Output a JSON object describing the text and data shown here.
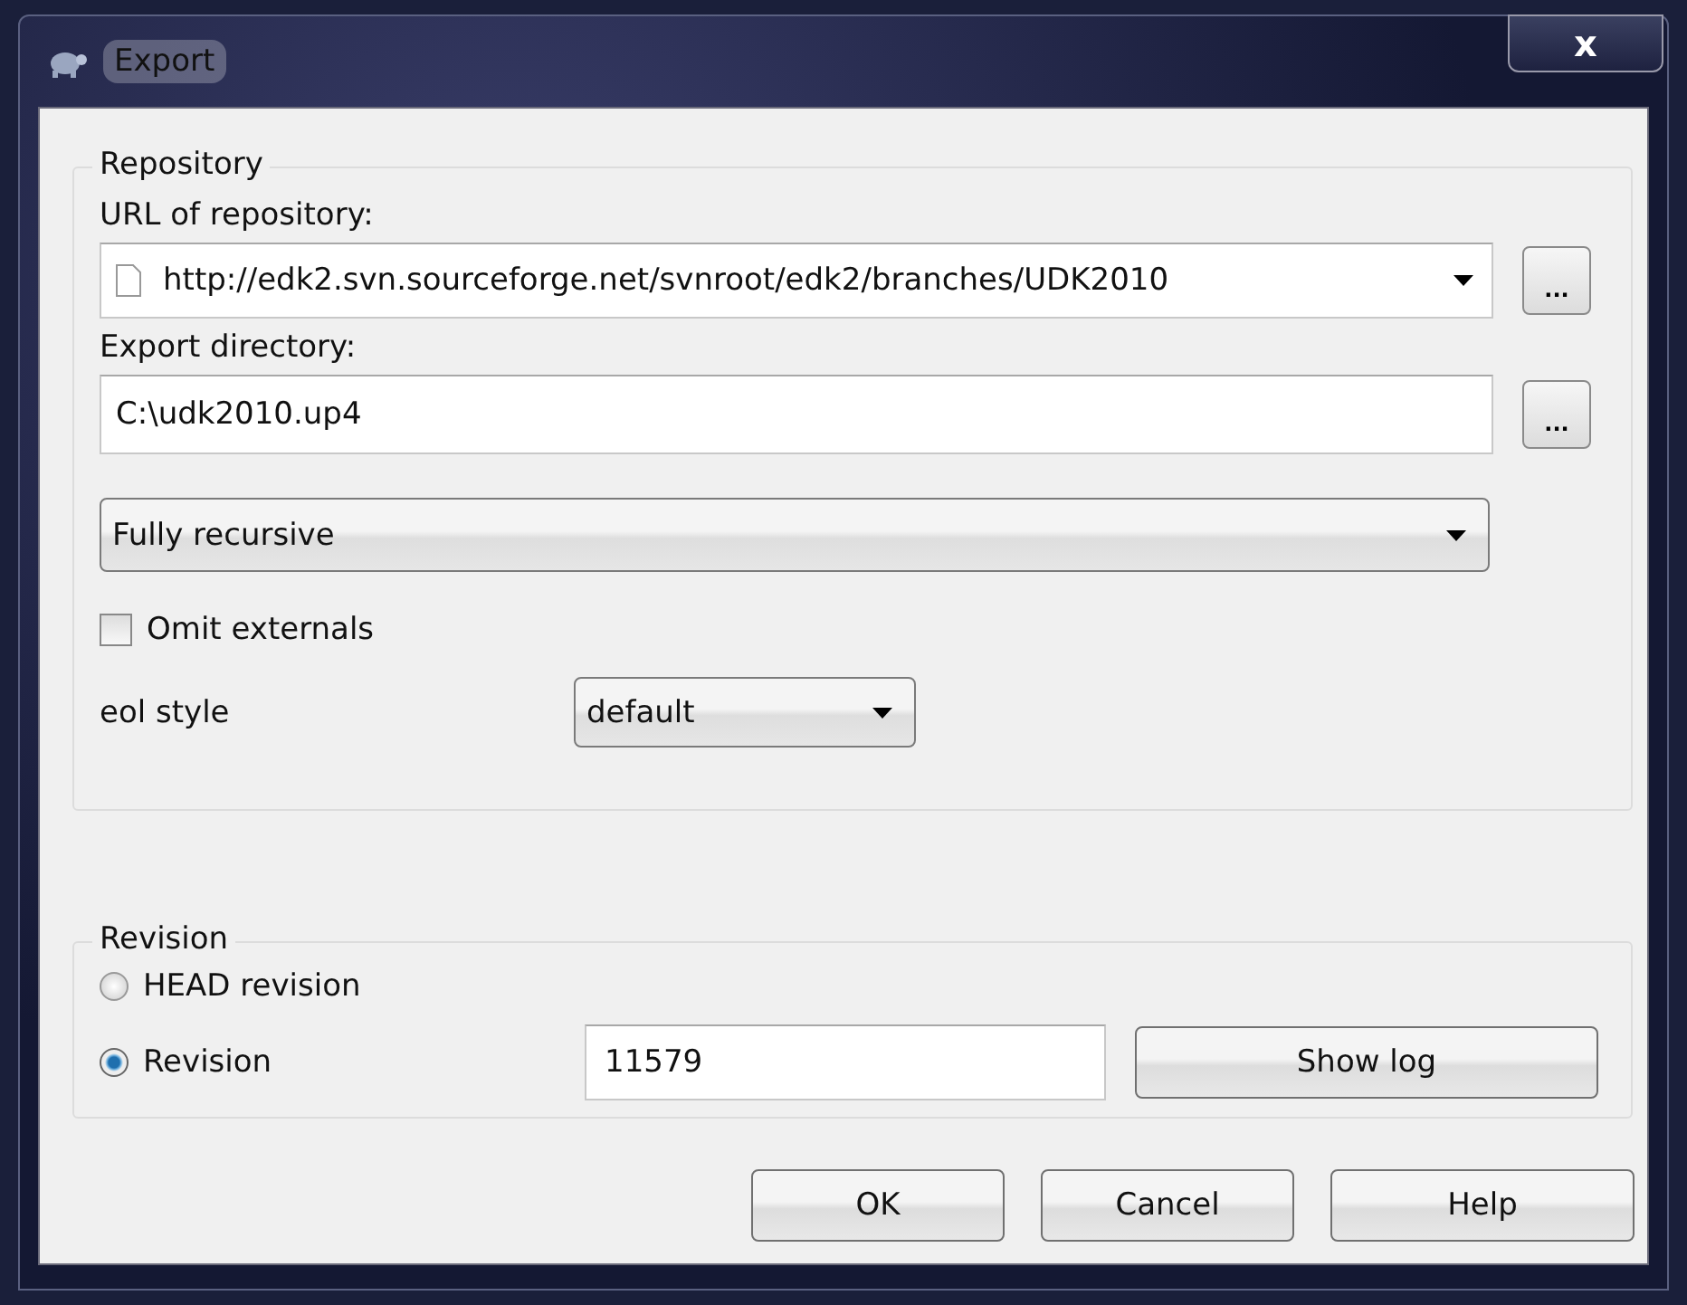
{
  "window": {
    "title": "Export",
    "close": "x"
  },
  "repository": {
    "label": "Repository",
    "url_label": "URL of repository:",
    "url": "http://edk2.svn.sourceforge.net/svnroot/edk2/branches/UDK2010",
    "url_browse": "...",
    "dir_label": "Export directory:",
    "dir": "C:\\udk2010.up4",
    "dir_browse": "...",
    "depth": "Fully recursive",
    "omit_externals": {
      "label": "Omit externals",
      "checked": false
    },
    "eol_label": "eol style",
    "eol": "default"
  },
  "revision": {
    "label": "Revision",
    "options": [
      {
        "label": "HEAD revision",
        "selected": false
      },
      {
        "label": "Revision",
        "selected": true
      }
    ],
    "number": "11579",
    "show_log": "Show log"
  },
  "buttons": [
    "OK",
    "Cancel",
    "Help"
  ]
}
